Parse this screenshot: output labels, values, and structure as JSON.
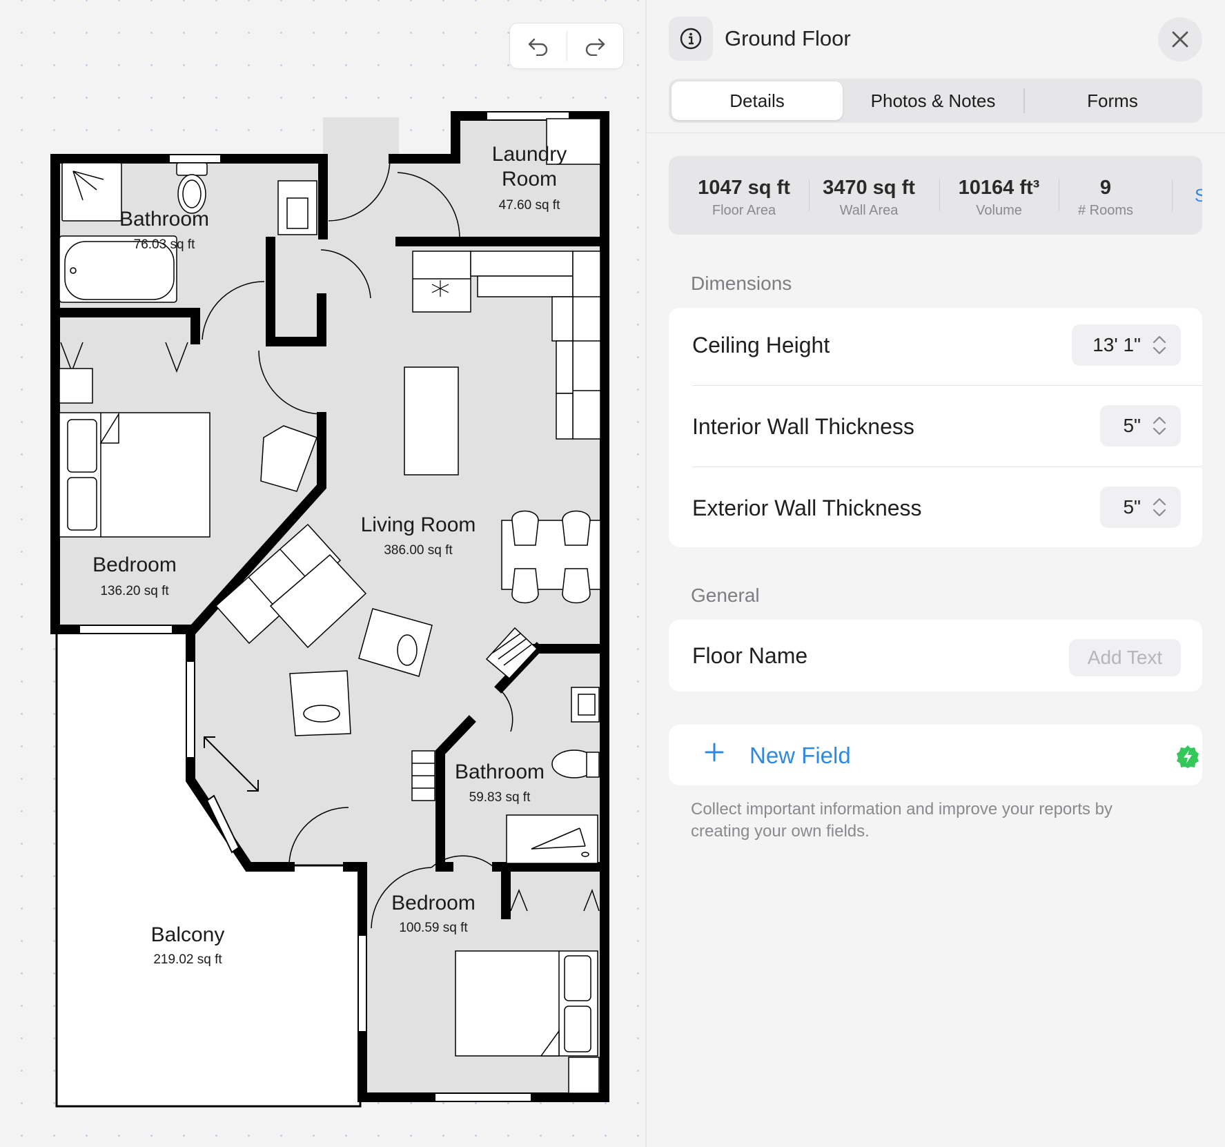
{
  "app": {
    "toolbar": {
      "undo_icon": "undo-icon",
      "redo_icon": "redo-icon"
    }
  },
  "floorplan": {
    "rooms": [
      {
        "name": "Bathroom",
        "area": "76.03 sq ft"
      },
      {
        "name": "Laundry",
        "name2": "Room",
        "area": "47.60 sq ft"
      },
      {
        "name": "Bedroom",
        "area": "136.20 sq ft"
      },
      {
        "name": "Living Room",
        "area": "386.00 sq ft"
      },
      {
        "name": "Bathroom",
        "area": "59.83 sq ft"
      },
      {
        "name": "Bedroom",
        "area": "100.59 sq ft"
      },
      {
        "name": "Balcony",
        "area": "219.02 sq ft"
      }
    ]
  },
  "panel": {
    "title": "Ground Floor",
    "info_icon": "info-icon",
    "close_icon": "close-icon",
    "tabs": [
      {
        "label": "Details",
        "active": true
      },
      {
        "label": "Photos & Notes",
        "active": false
      },
      {
        "label": "Forms",
        "active": false
      }
    ],
    "stats": [
      {
        "value": "1047 sq ft",
        "label": "Floor Area"
      },
      {
        "value": "3470 sq ft",
        "label": "Wall Area"
      },
      {
        "value": "10164 ft³",
        "label": "Volume"
      },
      {
        "value": "9",
        "label": "# Rooms"
      }
    ],
    "stats_more": "See",
    "dimensions": {
      "label": "Dimensions",
      "rows": [
        {
          "label": "Ceiling Height",
          "value": "13' 1\""
        },
        {
          "label": "Interior Wall Thickness",
          "value": "5\""
        },
        {
          "label": "Exterior Wall Thickness",
          "value": "5\""
        }
      ]
    },
    "general": {
      "label": "General",
      "floor_name_label": "Floor Name",
      "floor_name_placeholder": "Add Text"
    },
    "new_field": {
      "label": "New Field",
      "badge_icon": "bolt-badge-icon"
    },
    "footnote": "Collect important information and improve your reports by creating your own fields."
  },
  "colors": {
    "accent": "#2f89e0",
    "badge": "#34c759",
    "wall": "#000000",
    "floor": "#e1e1e1"
  }
}
